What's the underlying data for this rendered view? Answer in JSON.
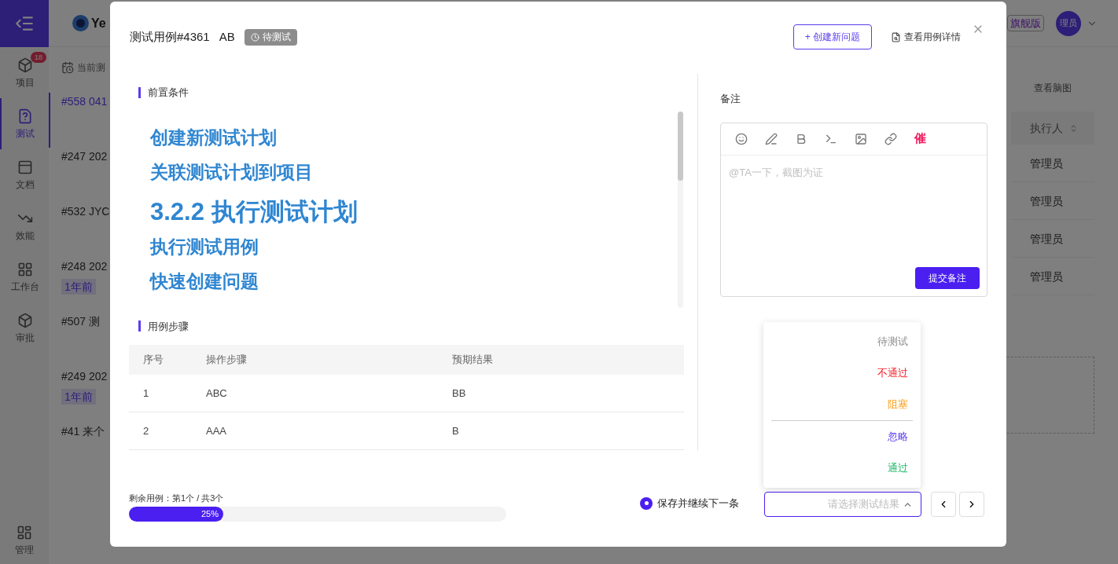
{
  "app": {
    "logo_text": "Ye",
    "edition_badge": "旗舰版",
    "avatar": "理员",
    "menu": [
      {
        "label": "项目",
        "badge": "18",
        "selected": false
      },
      {
        "label": "测试",
        "selected": true
      },
      {
        "label": "文档",
        "selected": false
      },
      {
        "label": "效能",
        "selected": false
      },
      {
        "label": "工作台",
        "selected": false
      },
      {
        "label": "审批",
        "selected": false
      }
    ],
    "bottom_menu": {
      "label": "管理"
    }
  },
  "case_list": {
    "header": "当前测",
    "items": [
      {
        "title": "#558 041",
        "selected": true
      },
      {
        "title": "#247 202",
        "selected": false
      },
      {
        "title": "#532 JYC",
        "selected": false
      },
      {
        "title": "#248 202",
        "tag": "1年前",
        "selected": false
      },
      {
        "title": "#507 测",
        "selected": false
      },
      {
        "title": "#249 202",
        "tag": "1年前",
        "selected": false
      },
      {
        "title": "#41 来个",
        "selected": false
      }
    ]
  },
  "background_table": {
    "view_link": "查看脑图",
    "column": "执行人",
    "rows": [
      "管理员",
      "管理员",
      "管理员",
      "管理员"
    ]
  },
  "modal": {
    "title": "测试用例#4361",
    "case_name": "AB",
    "status": "待测试",
    "create_button": "+ 创建新问题",
    "detail_link": "查看用例详情",
    "preconditions": {
      "heading": "前置条件",
      "lines": [
        {
          "text": "创建新测试计划",
          "kind": "h2"
        },
        {
          "text": "关联测试计划到项目",
          "kind": "h2"
        },
        {
          "text": "3.2.2 执行测试计划",
          "kind": "h1"
        },
        {
          "text": "执行测试用例",
          "kind": "h2"
        },
        {
          "text": "快速创建问题",
          "kind": "h2"
        }
      ]
    },
    "steps": {
      "heading": "用例步骤",
      "columns": [
        "序号",
        "操作步骤",
        "预期结果"
      ],
      "rows": [
        [
          "1",
          "ABC",
          "BB"
        ],
        [
          "2",
          "AAA",
          "B"
        ]
      ]
    },
    "remark": {
      "heading": "备注",
      "urge_label": "催",
      "placeholder": "@TA一下，截图为证",
      "submit": "提交备注"
    },
    "result_menu": {
      "options": [
        {
          "label": "待测试",
          "color": "#8c8c8c",
          "divider_before": false
        },
        {
          "label": "不通过",
          "color": "#f5222d",
          "divider_before": false
        },
        {
          "label": "阻塞",
          "color": "#fa9c16",
          "divider_before": false
        },
        {
          "label": "忽略",
          "color": "#5b3cf0",
          "divider_before": true
        },
        {
          "label": "通过",
          "color": "#1fb866",
          "divider_before": false
        }
      ]
    },
    "footer": {
      "progress_text": "剩余用例：第1个 / 共3个",
      "level": 0.25,
      "progress_label": "25%",
      "save_next": {
        "label": "保存并继续下一条",
        "checked": true
      },
      "result_select": {
        "placeholder": "请选择测试结果",
        "expanded": true
      }
    }
  }
}
